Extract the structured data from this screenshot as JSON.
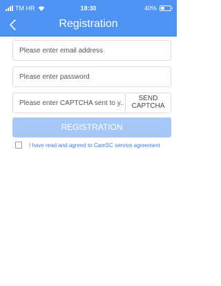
{
  "status_bar": {
    "carrier": "TM HR",
    "time": "18:30",
    "battery": "40%",
    "battery_level": 0.4
  },
  "header": {
    "title": "Registration",
    "back_icon": "chevron-left-icon",
    "color": "#4d93f3"
  },
  "form": {
    "email_placeholder": "Please enter email address",
    "password_placeholder": "Please enter password",
    "captcha_placeholder": "Please enter CAPTCHA sent to y...",
    "send_captcha_label": "SEND CAPTCHA",
    "register_label": "REGISTRATION",
    "register_color": "#a6c8f7"
  },
  "agreement": {
    "text": "I have read and agreed to CamSC service agreement",
    "checked": false,
    "link_color": "#3b7de8"
  }
}
